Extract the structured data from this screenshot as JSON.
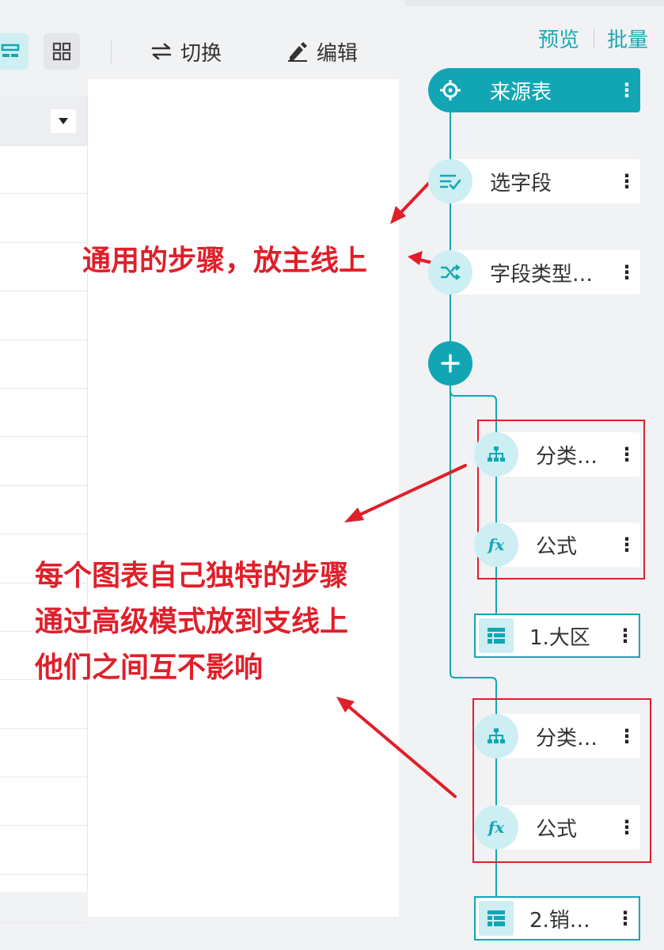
{
  "toolbar": {
    "switch_label": "切换",
    "edit_label": "编辑"
  },
  "header_links": {
    "preview": "预览",
    "batch": "批量"
  },
  "flow": {
    "source": {
      "label": "来源表",
      "icon": "crosshair-icon"
    },
    "main_steps": [
      {
        "label": "选字段",
        "icon": "select-fields-icon"
      },
      {
        "label": "字段类型…",
        "icon": "shuffle-icon"
      }
    ],
    "branches": [
      {
        "steps": [
          {
            "label": "分类…",
            "icon": "group-icon"
          },
          {
            "label": "公式",
            "icon": "formula-icon"
          }
        ],
        "output": {
          "label": "1.大区",
          "icon": "table-icon"
        }
      },
      {
        "steps": [
          {
            "label": "分类…",
            "icon": "group-icon"
          },
          {
            "label": "公式",
            "icon": "formula-icon"
          }
        ],
        "output": {
          "label": "2.销…",
          "icon": "table-icon"
        }
      }
    ]
  },
  "annotations": {
    "main_line": "通用的步骤，放主线上",
    "branch_lines": [
      "每个图表自己独特的步骤",
      "通过高级模式放到支线上",
      "他们之间互不影响"
    ]
  },
  "colors": {
    "accent": "#12a6b5",
    "accent_light": "#cdeef2",
    "annotation_red": "#e01f2a"
  }
}
